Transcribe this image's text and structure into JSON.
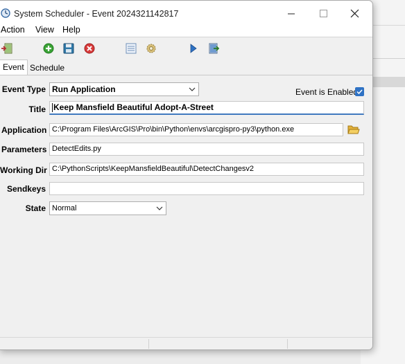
{
  "window": {
    "title": "System Scheduler - Event 2024321142817"
  },
  "menu": [
    "Action",
    "View",
    "Help"
  ],
  "toolbar": {
    "icons": [
      "exit-icon",
      "add-icon",
      "save-icon",
      "delete-icon",
      "list-icon",
      "settings-icon",
      "run-icon",
      "export-icon"
    ]
  },
  "tabs": [
    {
      "label": "Event",
      "active": true
    },
    {
      "label": "Schedule",
      "active": false
    }
  ],
  "form": {
    "event_type": {
      "label": "Event Type",
      "value": "Run Application"
    },
    "event_enabled": {
      "label": "Event is Enabled",
      "checked": true
    },
    "title": {
      "label": "Title",
      "value": "Keep Mansfield Beautiful Adopt-A-Street"
    },
    "application": {
      "label": "Application",
      "value": "C:\\Program Files\\ArcGIS\\Pro\\bin\\Python\\envs\\arcgispro-py3\\python.exe"
    },
    "parameters": {
      "label": "Parameters",
      "value": "DetectEdits.py"
    },
    "working_dir": {
      "label": "Working Dir",
      "value": "C:\\PythonScripts\\KeepMansfieldBeautiful\\DetectChangesv2"
    },
    "sendkeys": {
      "label": "Sendkeys",
      "value": ""
    },
    "state": {
      "label": "State",
      "value": "Normal"
    }
  },
  "colors": {
    "accent": "#2f72c4",
    "close_x": "#d32f2f",
    "add_green": "#3aa335"
  }
}
